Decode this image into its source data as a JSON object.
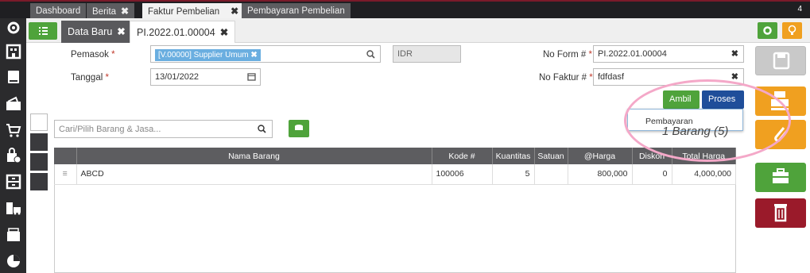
{
  "top_tabs": [
    {
      "label": "Dashboard"
    },
    {
      "label": "Berita"
    },
    {
      "label": "Faktur Pembelian"
    },
    {
      "label": "Pembayaran Pembelian"
    }
  ],
  "top_close": "✖",
  "top_count": "4",
  "sub_tabs": [
    {
      "label": "Data Baru"
    },
    {
      "label": "PI.2022.01.00004"
    }
  ],
  "form": {
    "pemasok_label": "Pemasok",
    "supplier_chip": "[V.00000] Supplier Umum",
    "currency": "IDR",
    "tanggal_label": "Tanggal",
    "tanggal_value": "13/01/2022",
    "no_form_label": "No Form #",
    "no_form_value": "PI.2022.01.00004",
    "no_faktur_label": "No Faktur #",
    "no_faktur_value": "fdfdasf",
    "required_mark": "*"
  },
  "buttons": {
    "ambil": "Ambil",
    "proses": "Proses"
  },
  "dropdown": {
    "item": "Pembayaran"
  },
  "item_count": "1 Barang (5)",
  "search": {
    "placeholder": "Cari/Pilih Barang & Jasa..."
  },
  "table": {
    "headers": [
      "Nama Barang",
      "Kode #",
      "Kuantitas",
      "Satuan",
      "@Harga",
      "Diskon",
      "Total Harga"
    ],
    "rows": [
      {
        "nama": "ABCD",
        "kode": "100006",
        "qty": "5",
        "satuan": "",
        "harga": "800,000",
        "diskon": "0",
        "total": "4,000,000"
      }
    ]
  },
  "colors": {
    "green": "#4fa33b",
    "orange": "#f0a020",
    "blue": "#1f4e9a",
    "red": "#9a1a2a",
    "annotation": "#f4a8c8"
  }
}
